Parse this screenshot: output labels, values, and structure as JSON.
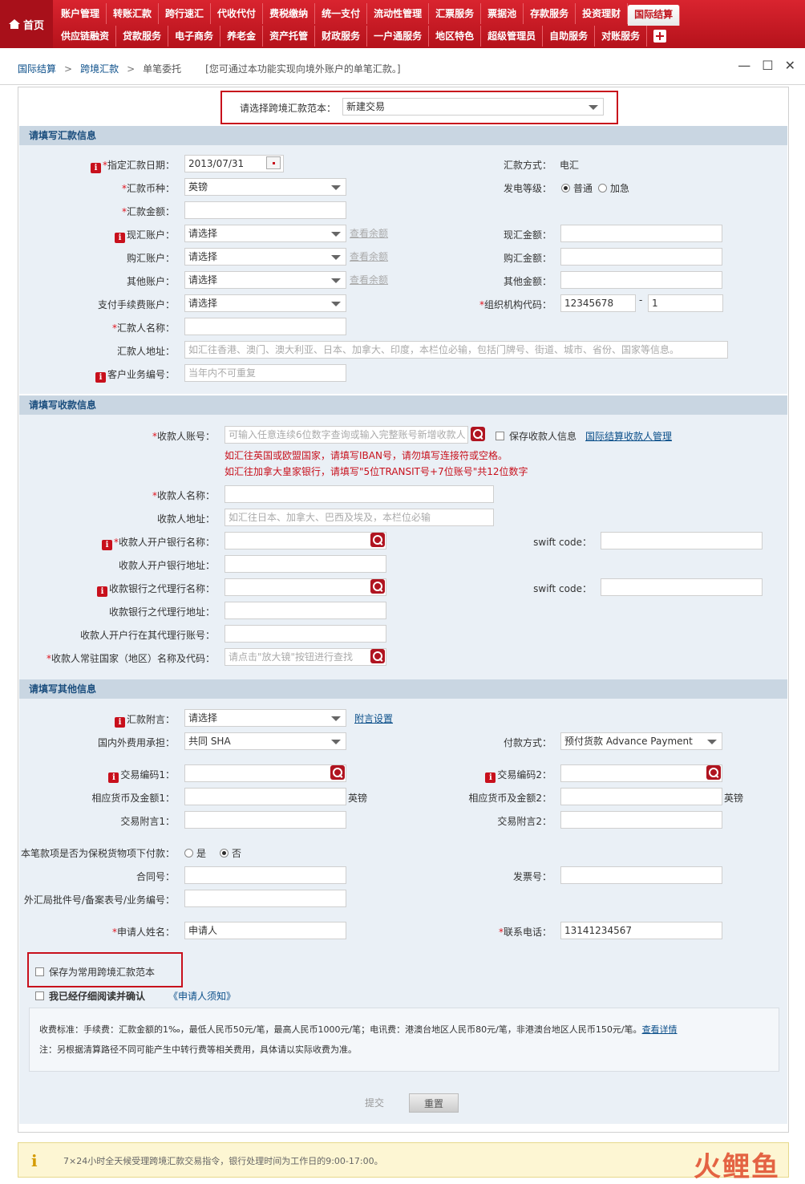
{
  "nav": {
    "home": "首页",
    "row1": [
      "账户管理",
      "转账汇款",
      "跨行速汇",
      "代收代付",
      "费税缴纳",
      "统一支付",
      "流动性管理",
      "汇票服务",
      "票据池",
      "存款服务",
      "投资理财",
      "国际结算"
    ],
    "row2": [
      "供应链融资",
      "贷款服务",
      "电子商务",
      "养老金",
      "资产托管",
      "财政服务",
      "一户通服务",
      "地区特色",
      "超级管理员",
      "自助服务",
      "对账服务"
    ],
    "active": "国际结算"
  },
  "breadcrumb": {
    "l1": "国际结算",
    "l2": "跨境汇款",
    "l3": "单笔委托",
    "hint": "[您可通过本功能实现向境外账户的单笔汇款。]"
  },
  "window": {
    "min": "—",
    "max": "☐",
    "close": "✕"
  },
  "template": {
    "label": "请选择跨境汇款范本：",
    "value": "新建交易"
  },
  "sections": {
    "remit": "请填写汇款信息",
    "payee": "请填写收款信息",
    "other": "请填写其他信息"
  },
  "remit": {
    "date_label": "指定汇款日期：",
    "date_value": "2013/07/31",
    "method_label": "汇款方式：",
    "method_value": "电汇",
    "currency_label": "汇款币种：",
    "currency_value": "英镑",
    "level_label": "发电等级：",
    "level_normal": "普通",
    "level_urgent": "加急",
    "amount_label": "汇款金额：",
    "spot_label": "现汇账户：",
    "spot_value": "请选择",
    "spot_link": "查看余额",
    "spot_amount_label": "现汇金额：",
    "buy_label": "购汇账户：",
    "buy_value": "请选择",
    "buy_link": "查看余额",
    "buy_amount_label": "购汇金额：",
    "other_label": "其他账户：",
    "other_value": "请选择",
    "other_link": "查看余额",
    "other_amount_label": "其他金额：",
    "fee_label": "支付手续费账户：",
    "fee_value": "请选择",
    "org_label": "组织机构代码：",
    "org_value1": "12345678",
    "org_dash": "-",
    "org_value2": "1",
    "name_label": "汇款人名称：",
    "addr_label": "汇款人地址：",
    "addr_placeholder": "如汇往香港、澳门、澳大利亚、日本、加拿大、印度，本栏位必输，包括门牌号、街道、城市、省份、国家等信息。",
    "bizno_label": "客户业务编号：",
    "bizno_placeholder": "当年内不可重复"
  },
  "payee": {
    "acct_label": "收款人账号：",
    "acct_placeholder": "可输入任意连续6位数字查询或输入完整账号新增收款人",
    "save_label": "保存收款人信息",
    "manage_link": "国际结算收款人管理",
    "warn1": "如汇往英国或欧盟国家，请填写IBAN号，请勿填写连接符或空格。",
    "warn2": "如汇往加拿大皇家银行，请填写\"5位TRANSIT号+7位账号\"共12位数字",
    "name_label": "收款人名称：",
    "addr_label": "收款人地址：",
    "addr_placeholder": "如汇往日本、加拿大、巴西及埃及，本栏位必输",
    "bank_label": "收款人开户银行名称：",
    "swift_label1": "swift code：",
    "bank_addr_label": "收款人开户银行地址：",
    "agent_label": "收款银行之代理行名称：",
    "swift_label2": "swift code：",
    "agent_addr_label": "收款银行之代理行地址：",
    "agent_acct_label": "收款人开户行在其代理行账号：",
    "country_label": "收款人常驻国家（地区）名称及代码：",
    "country_placeholder": "请点击\"放大镜\"按钮进行查找"
  },
  "other": {
    "memo_label": "汇款附言：",
    "memo_value": "请选择",
    "memo_link": "附言设置",
    "charge_label": "国内外费用承担：",
    "charge_value": "共同 SHA",
    "paytype_label": "付款方式：",
    "paytype_value": "预付货款 Advance Payment",
    "code1_label": "交易编码1：",
    "code2_label": "交易编码2：",
    "amt1_label": "相应货币及金额1：",
    "amt1_unit": "英镑",
    "amt2_label": "相应货币及金额2：",
    "amt2_unit": "英镑",
    "note1_label": "交易附言1：",
    "note2_label": "交易附言2：",
    "bonded_label": "本笔款项是否为保税货物项下付款：",
    "bonded_yes": "是",
    "bonded_no": "否",
    "contract_label": "合同号：",
    "invoice_label": "发票号：",
    "approval_label": "外汇局批件号/备案表号/业务编号：",
    "applicant_label": "申请人姓名：",
    "applicant_value": "申请人",
    "phone_label": "联系电话：",
    "phone_value": "13141234567"
  },
  "save_template": "保存为常用跨境汇款范本",
  "confirm": "我已经仔细阅读并确认",
  "notice_link": "《申请人须知》",
  "fee_note": {
    "line1": "收费标准：手续费：汇款金额的1‰，最低人民币50元/笔，最高人民币1000元/笔；电讯费：港澳台地区人民币80元/笔，非港澳台地区人民币150元/笔。",
    "line1_link": "查看详情",
    "line2": "注：另根据清算路径不同可能产生中转行费等相关费用，具体请以实际收费为准。"
  },
  "buttons": {
    "submit": "提交",
    "reset": "重置"
  },
  "footer": "7×24小时全天候受理跨境汇款交易指令，银行处理时间为工作日的9:00-17:00。",
  "watermark": "火鲤鱼"
}
